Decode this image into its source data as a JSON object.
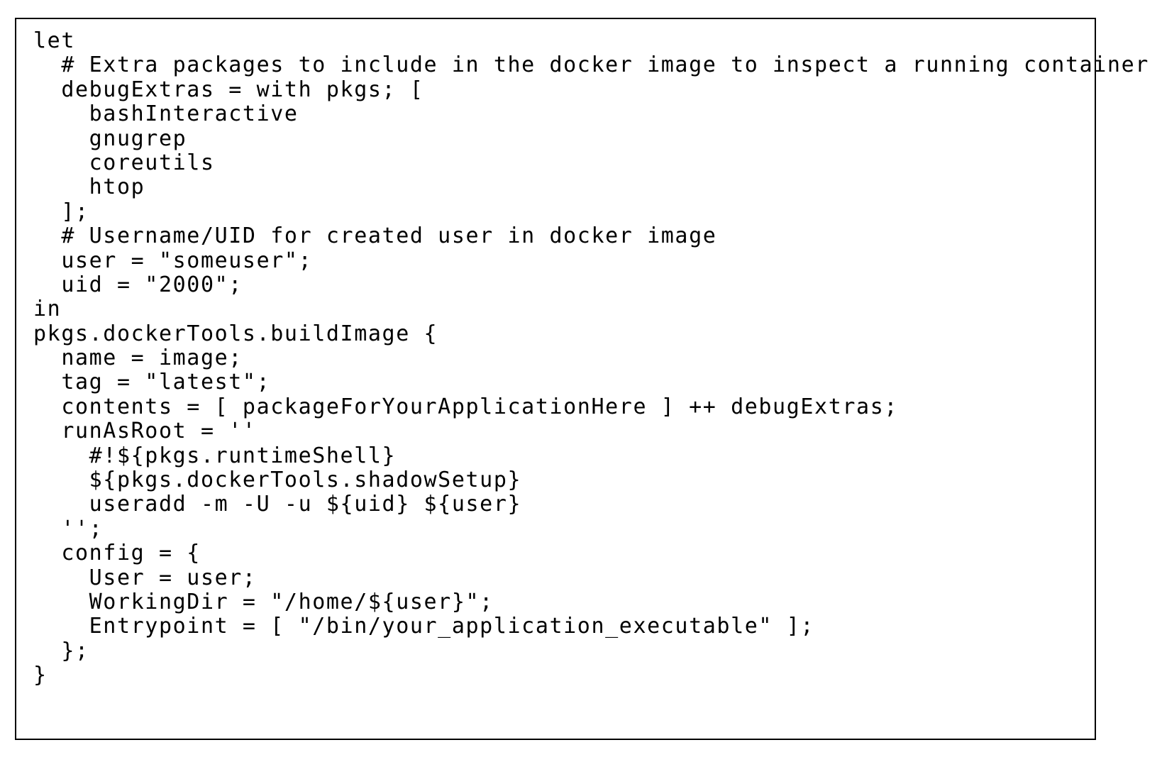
{
  "code": {
    "language": "nix",
    "lines": [
      "let",
      "  # Extra packages to include in the docker image to inspect a running container",
      "  debugExtras = with pkgs; [",
      "    bashInteractive",
      "    gnugrep",
      "    coreutils",
      "    htop",
      "  ];",
      "  # Username/UID for created user in docker image",
      "  user = \"someuser\";",
      "  uid = \"2000\";",
      "in",
      "pkgs.dockerTools.buildImage {",
      "  name = image;",
      "  tag = \"latest\";",
      "  contents = [ packageForYourApplicationHere ] ++ debugExtras;",
      "  runAsRoot = ''",
      "    #!${pkgs.runtimeShell}",
      "    ${pkgs.dockerTools.shadowSetup}",
      "    useradd -m -U -u ${uid} ${user}",
      "  '';",
      "  config = {",
      "    User = user;",
      "    WorkingDir = \"/home/${user}\";",
      "    Entrypoint = [ \"/bin/your_application_executable\" ];",
      "  };",
      "}"
    ]
  }
}
